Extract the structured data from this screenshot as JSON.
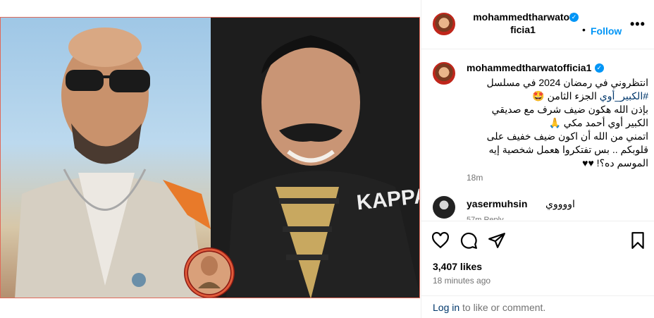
{
  "post": {
    "author": "mohammedtharwatofficia1",
    "author_line1": "mohammedtharwatof",
    "author_line2": "ficia1",
    "follow_label": "Follow",
    "dot": "•",
    "more_label": "•••",
    "verified_mark": "✓"
  },
  "caption": {
    "author": "mohammedtharwatofficia1",
    "line1": "انتظروني في رمضان 2024 في مسلسل",
    "hashtag": "#الكبير_أوي",
    "line2_rest": " الجزء الثامن 🤩",
    "line3": "بإذن الله هكون ضيف شرف مع صديقي",
    "line4": "الكبير أوي أحمد مكي 🙏",
    "line5": "اتمني من الله أن اكون ضيف خفيف على",
    "line6": "قلوبكم .. بس تفتكروا هعمل شخصية إيه",
    "line7": "الموسم ده؟! ♥♥",
    "time": "18m"
  },
  "comment": {
    "user": "yasermuhsin",
    "text": "اووووي",
    "sub": "57m Reply"
  },
  "actions": {
    "like_icon": "heart-icon",
    "comment_icon": "comment-icon",
    "share_icon": "share-icon",
    "save_icon": "bookmark-icon"
  },
  "stats": {
    "likes": "3,407 likes",
    "ago": "18 minutes ago"
  },
  "footer": {
    "login_link": "Log in",
    "login_rest": " to like or comment."
  },
  "colors": {
    "accent": "#0095f6",
    "link": "#00376b",
    "muted": "#737373",
    "media_border": "#e06a5a"
  }
}
